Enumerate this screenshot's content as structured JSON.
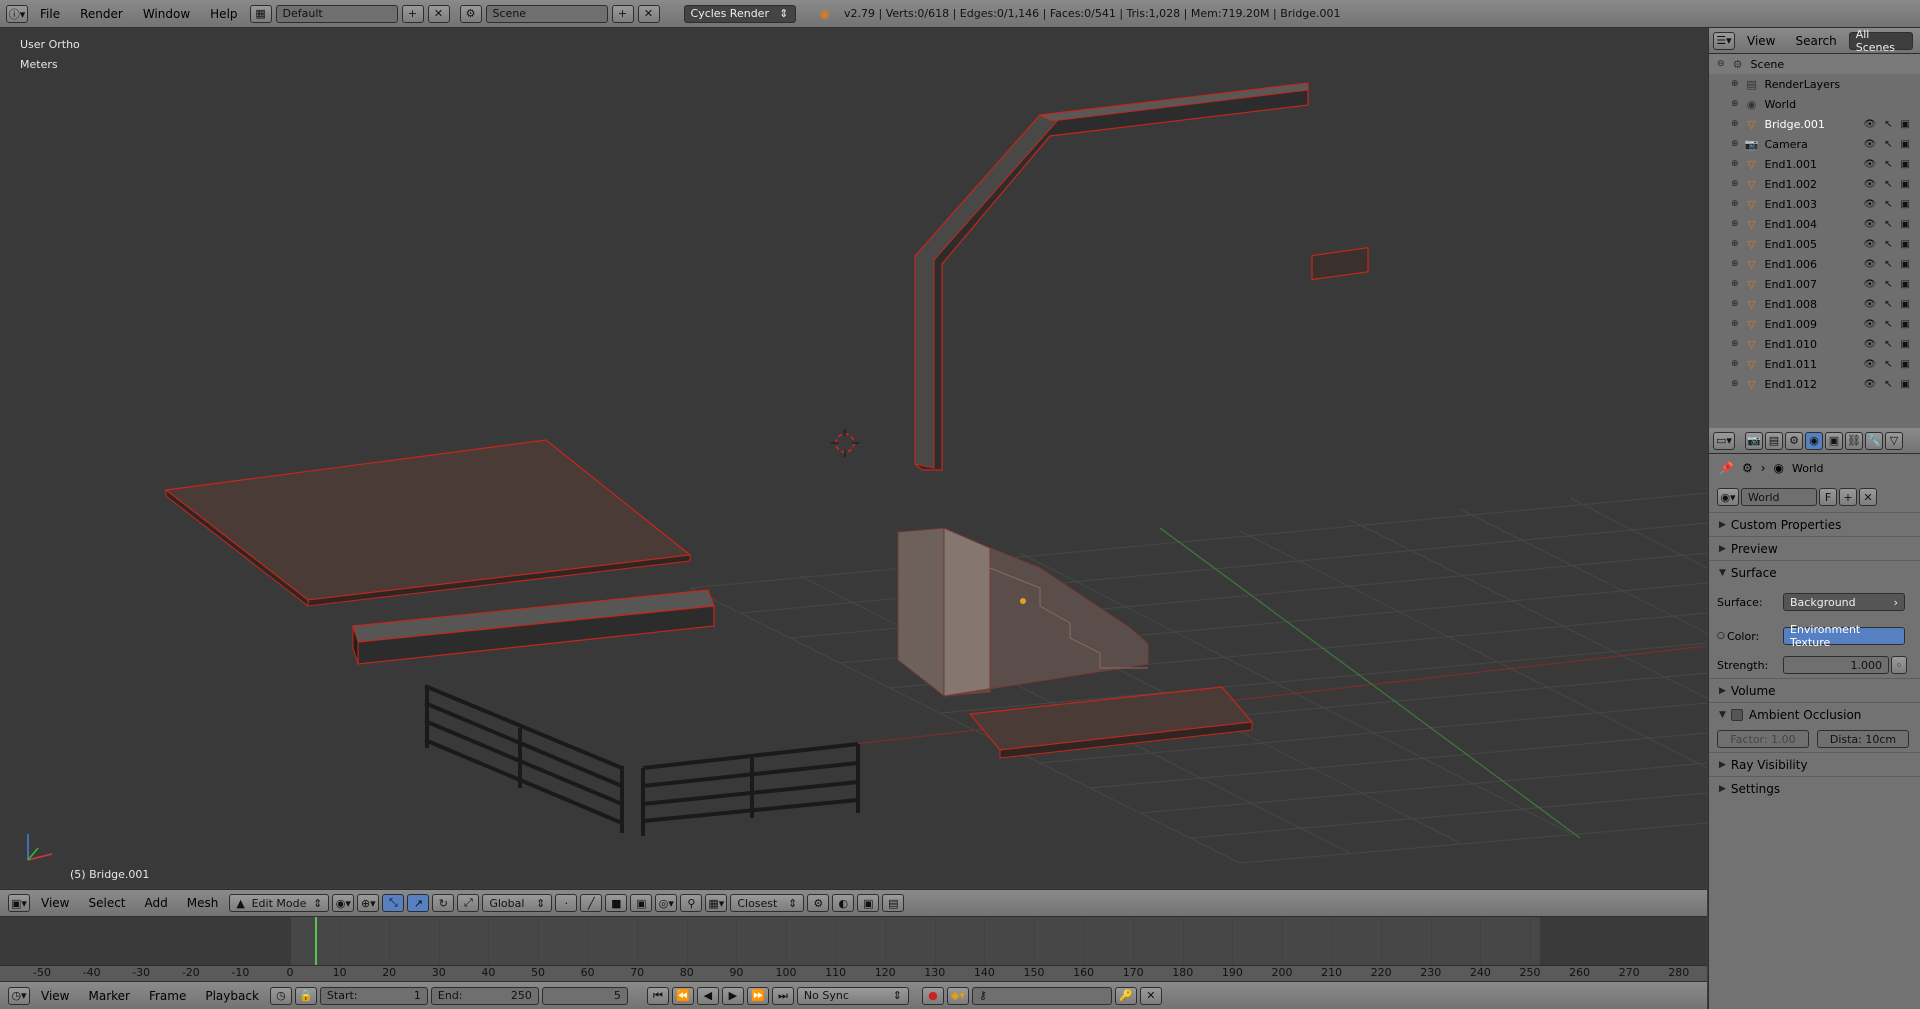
{
  "topbar": {
    "menus": [
      "File",
      "Render",
      "Window",
      "Help"
    ],
    "screen_layout": "Default",
    "scene": "Scene",
    "engine": "Cycles Render",
    "stats": "v2.79 | Verts:0/618 | Edges:0/1,146 | Faces:0/541 | Tris:1,028 | Mem:719.20M | Bridge.001"
  },
  "viewport": {
    "view_name": "User Ortho",
    "units": "Meters",
    "active_object": "(5) Bridge.001"
  },
  "vp_header": {
    "menus": [
      "View",
      "Select",
      "Add",
      "Mesh"
    ],
    "mode": "Edit Mode",
    "orientation": "Global",
    "snap_target": "Closest"
  },
  "timeline": {
    "ticks": [
      "-50",
      "-40",
      "-30",
      "-20",
      "-10",
      "0",
      "10",
      "20",
      "30",
      "40",
      "50",
      "60",
      "70",
      "80",
      "90",
      "100",
      "110",
      "120",
      "130",
      "140",
      "150",
      "160",
      "170",
      "180",
      "190",
      "200",
      "210",
      "220",
      "230",
      "240",
      "250",
      "260",
      "270",
      "280"
    ],
    "menus": [
      "View",
      "Marker",
      "Frame",
      "Playback"
    ],
    "start_label": "Start:",
    "start_value": "1",
    "end_label": "End:",
    "end_value": "250",
    "current_frame": "5",
    "sync": "No Sync"
  },
  "outliner": {
    "menus": [
      "View",
      "Search"
    ],
    "filter": "All Scenes",
    "items": [
      {
        "label": "Scene",
        "icon": "scene-icon"
      },
      {
        "label": "RenderLayers",
        "icon": "renderlayers-icon"
      },
      {
        "label": "World",
        "icon": "world-icon"
      },
      {
        "label": "Bridge.001",
        "icon": "mesh-icon"
      },
      {
        "label": "Camera",
        "icon": "camera-icon"
      },
      {
        "label": "End1.001",
        "icon": "mesh-icon"
      },
      {
        "label": "End1.002",
        "icon": "mesh-icon"
      },
      {
        "label": "End1.003",
        "icon": "mesh-icon"
      },
      {
        "label": "End1.004",
        "icon": "mesh-icon"
      },
      {
        "label": "End1.005",
        "icon": "mesh-icon"
      },
      {
        "label": "End1.006",
        "icon": "mesh-icon"
      },
      {
        "label": "End1.007",
        "icon": "mesh-icon"
      },
      {
        "label": "End1.008",
        "icon": "mesh-icon"
      },
      {
        "label": "End1.009",
        "icon": "mesh-icon"
      },
      {
        "label": "End1.010",
        "icon": "mesh-icon"
      },
      {
        "label": "End1.011",
        "icon": "mesh-icon"
      },
      {
        "label": "End1.012",
        "icon": "mesh-icon"
      }
    ]
  },
  "properties": {
    "context": "World",
    "world_name": "World",
    "fake_user": "F",
    "panels": {
      "custom": "Custom Properties",
      "preview": "Preview",
      "surface": "Surface",
      "volume": "Volume",
      "ao": "Ambient Occlusion",
      "ray": "Ray Visibility",
      "settings": "Settings"
    },
    "surface_label": "Surface:",
    "surface_value": "Background",
    "color_label": "Color:",
    "color_value": "Environment Texture",
    "strength_label": "Strength:",
    "strength_value": "1.000",
    "factor": "Factor: 1.00",
    "distance": "Dista: 10cm"
  },
  "colors": {
    "selection_outline": "#d22a1f",
    "active_button": "#5680c2",
    "grid": "#4a4a4a"
  }
}
